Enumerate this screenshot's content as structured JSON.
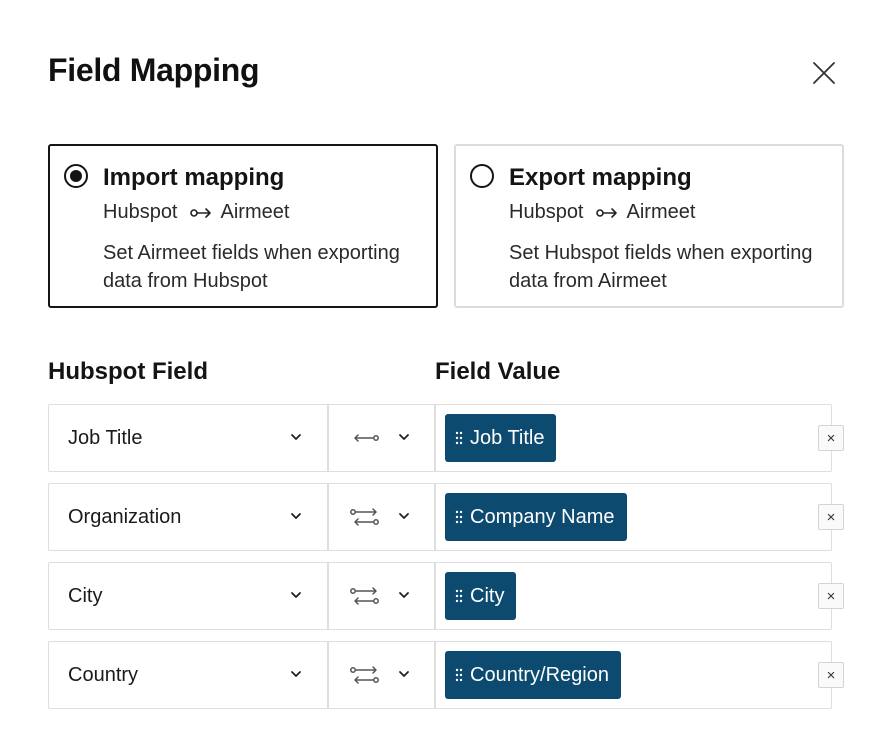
{
  "dialog": {
    "title": "Field Mapping"
  },
  "mapping_options": [
    {
      "title": "Import mapping",
      "from": "Hubspot",
      "to": "Airmeet",
      "description": "Set Airmeet fields when exporting data from Hubspot",
      "selected": true
    },
    {
      "title": "Export mapping",
      "from": "Hubspot",
      "to": "Airmeet",
      "description": "Set Hubspot fields when exporting data from Airmeet",
      "selected": false
    }
  ],
  "columns": {
    "source": "Hubspot Field",
    "value": "Field Value"
  },
  "rows": [
    {
      "field": "Job Title",
      "sync_icon": "one-way-sync-icon",
      "value": "Job Title",
      "remove_label": "×"
    },
    {
      "field": "Organization",
      "sync_icon": "two-way-sync-icon",
      "value": "Company Name",
      "remove_label": "×"
    },
    {
      "field": "City",
      "sync_icon": "two-way-sync-icon",
      "value": "City",
      "remove_label": "×"
    },
    {
      "field": "Country",
      "sync_icon": "two-way-sync-icon",
      "value": "Country/Region",
      "remove_label": "×"
    }
  ],
  "colors": {
    "chip_background": "#0c4a70",
    "text": "#141414",
    "border": "#dedede"
  }
}
